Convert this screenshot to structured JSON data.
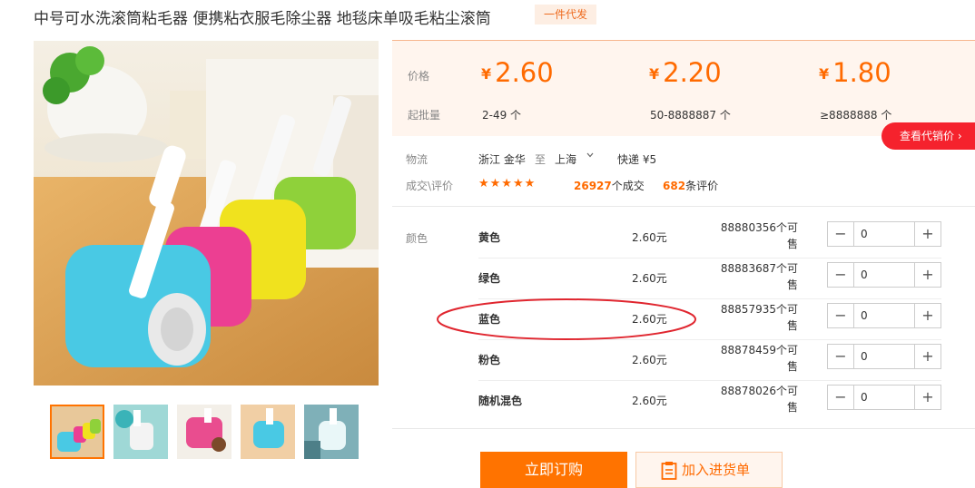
{
  "product": {
    "title": "中号可水洗滚筒粘毛器 便携粘衣服毛除尘器 地毯床单吸毛粘尘滚筒",
    "tag": "一件代发"
  },
  "pricing": {
    "price_label": "价格",
    "moq_label": "起批量",
    "currency": "¥",
    "tiers": [
      {
        "price": "2.60",
        "qty": "2-49 个"
      },
      {
        "price": "2.20",
        "qty": "50-8888887 个"
      },
      {
        "price": "1.80",
        "qty": "≥8888888 个"
      }
    ],
    "agent_price_button": "查看代销价 ›"
  },
  "logistics": {
    "label": "物流",
    "from": "浙江 金华",
    "to_word": "至",
    "to": "上海",
    "express": "快递 ¥5"
  },
  "deals": {
    "label": "成交\\评价",
    "stars": "★★★★★",
    "rating_stars": 5,
    "deals_count": "26927",
    "deals_suffix": "个成交",
    "reviews_count": "682",
    "reviews_suffix": "条评价"
  },
  "sku": {
    "label": "颜色",
    "rows": [
      {
        "name": "黄色",
        "price": "2.60元",
        "stock_line1": "88880356个可",
        "stock_line2": "售",
        "qty": "0"
      },
      {
        "name": "绿色",
        "price": "2.60元",
        "stock_line1": "88883687个可",
        "stock_line2": "售",
        "qty": "0"
      },
      {
        "name": "蓝色",
        "price": "2.60元",
        "stock_line1": "88857935个可",
        "stock_line2": "售",
        "qty": "0"
      },
      {
        "name": "粉色",
        "price": "2.60元",
        "stock_line1": "88878459个可",
        "stock_line2": "售",
        "qty": "0"
      },
      {
        "name": "随机混色",
        "price": "2.60元",
        "stock_line1": "88878026个可",
        "stock_line2": "售",
        "qty": "0"
      }
    ]
  },
  "actions": {
    "order": "立即订购",
    "cart": "加入进货单"
  },
  "colors": {
    "accent": "#ff7300",
    "price": "#ff6a00",
    "red_button": "#f5222d",
    "annotation": "#e0262f"
  }
}
